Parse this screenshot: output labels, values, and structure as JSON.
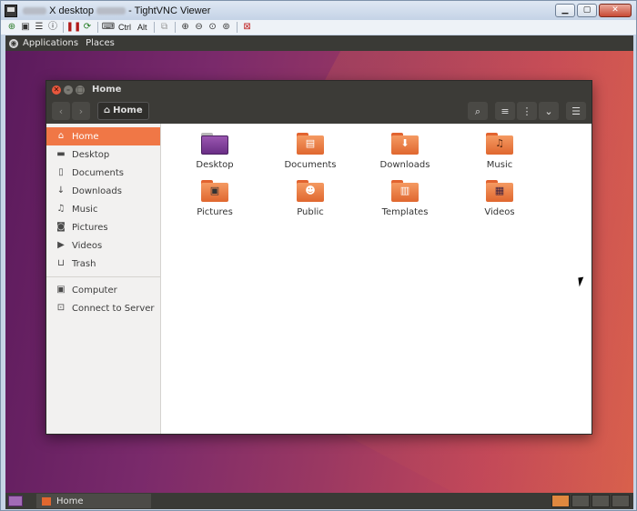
{
  "vnc": {
    "title_suffix": "X desktop",
    "title_tail": "- TightVNC Viewer",
    "toolbar": {
      "ctrl_label": "Ctrl",
      "alt_label": "Alt"
    }
  },
  "top_panel": {
    "applications": "Applications",
    "places": "Places"
  },
  "nautilus": {
    "window_title": "Home",
    "path_label": "Home",
    "sidebar": [
      {
        "label": "Home",
        "icon": "home-icon",
        "active": true
      },
      {
        "label": "Desktop",
        "icon": "desktop-folder-icon"
      },
      {
        "label": "Documents",
        "icon": "document-icon"
      },
      {
        "label": "Downloads",
        "icon": "download-icon"
      },
      {
        "label": "Music",
        "icon": "music-icon"
      },
      {
        "label": "Pictures",
        "icon": "camera-icon"
      },
      {
        "label": "Videos",
        "icon": "video-icon"
      },
      {
        "label": "Trash",
        "icon": "trash-icon"
      },
      {
        "label": "Computer",
        "icon": "computer-icon"
      },
      {
        "label": "Connect to Server",
        "icon": "server-icon"
      }
    ],
    "files": [
      {
        "label": "Desktop",
        "icon": "desktop-folder-icon"
      },
      {
        "label": "Documents",
        "icon": "documents-folder-icon"
      },
      {
        "label": "Downloads",
        "icon": "downloads-folder-icon"
      },
      {
        "label": "Music",
        "icon": "music-folder-icon"
      },
      {
        "label": "Pictures",
        "icon": "pictures-folder-icon"
      },
      {
        "label": "Public",
        "icon": "public-folder-icon"
      },
      {
        "label": "Templates",
        "icon": "templates-folder-icon"
      },
      {
        "label": "Videos",
        "icon": "videos-folder-icon"
      }
    ]
  },
  "taskbar": {
    "task_label": "Home"
  },
  "colors": {
    "accent": "#f07746",
    "panel": "#3c3b37",
    "folder": "#e0672f"
  }
}
